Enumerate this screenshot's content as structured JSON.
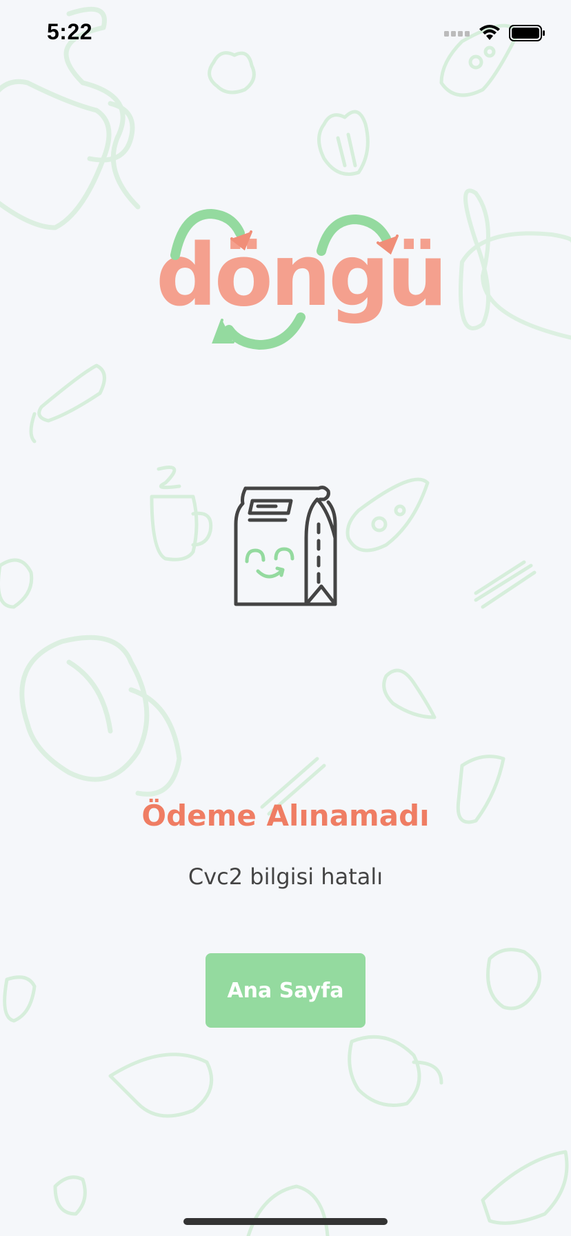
{
  "status_bar": {
    "time": "5:22",
    "signal_icon": "cellular-signal-icon",
    "wifi_icon": "wifi-icon",
    "battery_icon": "battery-icon"
  },
  "logo": {
    "text": "döngü",
    "text_color": "#f4a08e",
    "arrow_color": "#94da9f"
  },
  "illustration": {
    "icon": "smiling-bag-icon"
  },
  "result": {
    "title": "Ödeme Alınamadı",
    "message": "Cvc2 bilgisi hatalı"
  },
  "actions": {
    "home_label": "Ana Sayfa"
  },
  "colors": {
    "background": "#f5f7fa",
    "accent_green": "#94da9f",
    "error_orange": "#ef7d63",
    "doodle_green": "#d8efdc"
  }
}
